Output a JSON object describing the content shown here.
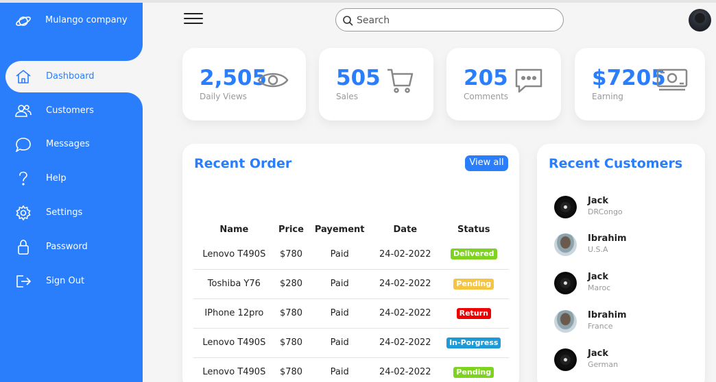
{
  "brand": {
    "name": "Mulango company",
    "icon": "planet-icon"
  },
  "sidebar": {
    "items": [
      {
        "label": "Dashboard",
        "icon": "home-icon",
        "active": true
      },
      {
        "label": "Customers",
        "icon": "people-icon"
      },
      {
        "label": "Messages",
        "icon": "chat-icon"
      },
      {
        "label": "Help",
        "icon": "help-icon"
      },
      {
        "label": "Settings",
        "icon": "gear-icon"
      },
      {
        "label": "Password",
        "icon": "lock-icon"
      },
      {
        "label": "Sign Out",
        "icon": "sign-out-icon"
      }
    ]
  },
  "topbar": {
    "search_placeholder": "Search"
  },
  "stats": [
    {
      "value": "2,505",
      "label": "Daily Views",
      "icon": "eye-icon"
    },
    {
      "value": "505",
      "label": "Sales",
      "icon": "cart-icon"
    },
    {
      "value": "205",
      "label": "Comments",
      "icon": "comment-icon"
    },
    {
      "value": "$7205",
      "label": "Earning",
      "icon": "money-icon"
    }
  ],
  "recent_order": {
    "title": "Recent Order",
    "view_all": "View all",
    "columns": [
      "Name",
      "Price",
      "Payement",
      "Date",
      "Status"
    ],
    "rows": [
      {
        "name": "Lenovo T490S",
        "price": "$780",
        "payment": "Paid",
        "date": "24-02-2022",
        "status": "Delivered"
      },
      {
        "name": "Toshiba Y76",
        "price": "$280",
        "payment": "Paid",
        "date": "24-02-2022",
        "status": "Pending"
      },
      {
        "name": "IPhone 12pro",
        "price": "$780",
        "payment": "Paid",
        "date": "24-02-2022",
        "status": "Return"
      },
      {
        "name": "Lenovo T490S",
        "price": "$780",
        "payment": "Paid",
        "date": "24-02-2022",
        "status": "In-Porgress"
      },
      {
        "name": "Lenovo T490S",
        "price": "$780",
        "payment": "Paid",
        "date": "24-02-2022",
        "status": "Pending"
      }
    ],
    "status_colors": {
      "Delivered": "#7ed321",
      "Pending": "#f5c542",
      "Return": "#ee0000",
      "In-Porgress": "#1e9ad6",
      "Pending-green": "#7ed321"
    }
  },
  "recent_customers": {
    "title": "Recent Customers",
    "list": [
      {
        "name": "Jack",
        "location": "DRCongo"
      },
      {
        "name": "Ibrahim",
        "location": "U.S.A"
      },
      {
        "name": "Jack",
        "location": "Maroc"
      },
      {
        "name": "Ibrahim",
        "location": "France"
      },
      {
        "name": "Jack",
        "location": "German"
      }
    ]
  },
  "colors": {
    "accent": "#2a7dfb",
    "background": "#f5f5f5"
  }
}
